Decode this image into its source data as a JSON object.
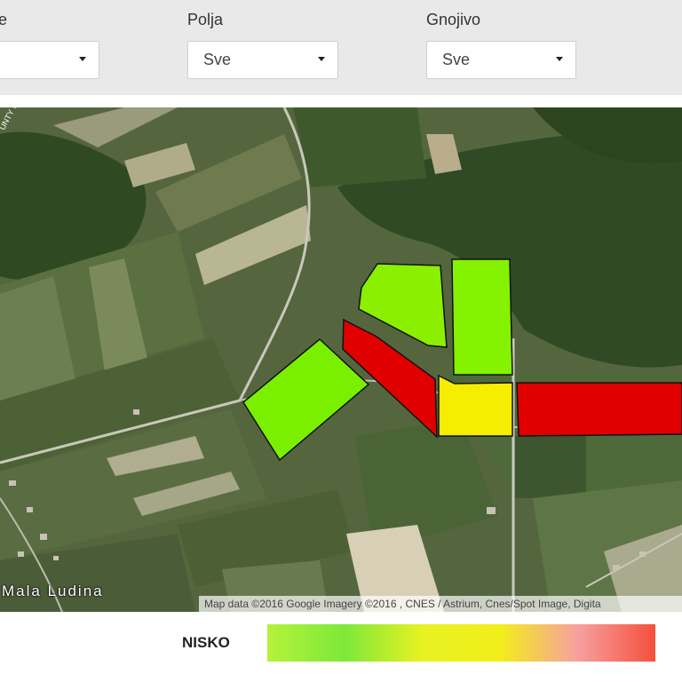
{
  "filters": {
    "first": {
      "label": "e",
      "value": ""
    },
    "fields": {
      "label": "Polja",
      "value": "Sve"
    },
    "fertilizer": {
      "label": "Gnojivo",
      "value": "Sve"
    }
  },
  "map": {
    "place_label": "Mala Ludina",
    "road_label": "UNTY\nWINA COU",
    "attribution": "Map data ©2016 Google Imagery ©2016 , CNES / Astrium, Cnes/Spot Image, Digita",
    "field_colors": {
      "green": "#76ee00",
      "lightgreen": "#88f000",
      "yellow": "#f5ee00",
      "red": "#e10000"
    }
  },
  "legend": {
    "label": "NISKO",
    "gradient": [
      "#b4f23a",
      "#7ee83a",
      "#e8f222",
      "#f2ee1a",
      "#f7a0a0",
      "#f4503a"
    ]
  }
}
